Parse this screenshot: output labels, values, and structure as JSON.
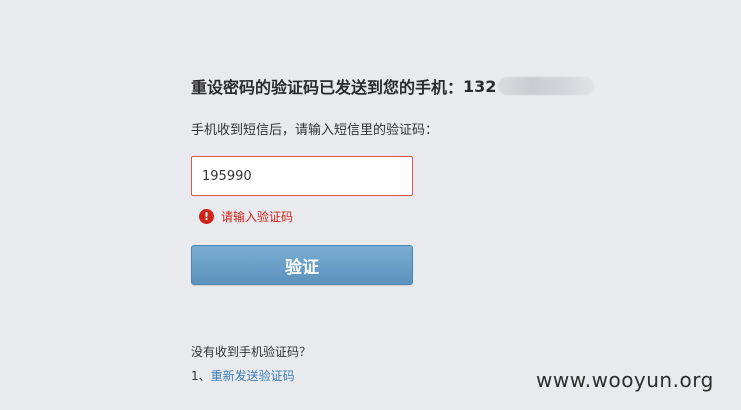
{
  "verification": {
    "title_prefix": "重设密码的验证码已发送到您的手机：",
    "phone_visible": "132",
    "instruction": "手机收到短信后，请输入短信里的验证码：",
    "code_value": "195990",
    "error_icon_glyph": "!",
    "error_message": "请输入验证码",
    "verify_button_label": "验证",
    "not_received_label": "没有收到手机验证码？",
    "resend_prefix": "1、",
    "resend_link": "重新发送验证码"
  },
  "watermark": {
    "text": "www.wooyun.org"
  },
  "colors": {
    "background": "#e8eaed",
    "error": "#d0241b",
    "button": "#6aa0c8",
    "link": "#3e7bb5"
  },
  "icons": {
    "error": "exclamation-circle-icon"
  }
}
